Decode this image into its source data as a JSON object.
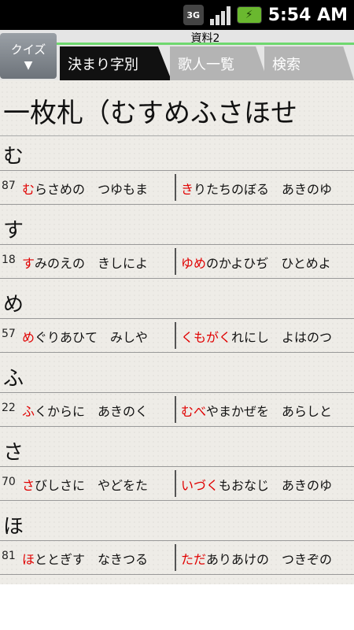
{
  "status_bar": {
    "network": "3G",
    "time": "5:54 AM"
  },
  "header": {
    "quiz_label": "クイズ",
    "quiz_arrow": "▼",
    "section_title": "資料2",
    "tabs": [
      {
        "label": "決まり字別",
        "active": true
      },
      {
        "label": "歌人一覧",
        "active": false
      },
      {
        "label": "検索",
        "active": false
      }
    ]
  },
  "content": {
    "title": "一枚札（むすめふさほせ",
    "groups": [
      {
        "heading": "む",
        "number": "87",
        "left_kimari": "む",
        "left_rest": "らさめの　つゆもま",
        "right_kimari": "き",
        "right_rest": "りたちのぼる　あきのゆ"
      },
      {
        "heading": "す",
        "number": "18",
        "left_kimari": "す",
        "left_rest": "みのえの　きしによ",
        "right_kimari": "ゆめ",
        "right_rest": "のかよひぢ　ひとめよ"
      },
      {
        "heading": "め",
        "number": "57",
        "left_kimari": "め",
        "left_rest": "ぐりあひて　みしや",
        "right_kimari": "くもがく",
        "right_rest": "れにし　よはのつ"
      },
      {
        "heading": "ふ",
        "number": "22",
        "left_kimari": "ふ",
        "left_rest": "くからに　あきのく",
        "right_kimari": "むべ",
        "right_rest": "やまかぜを　あらしと"
      },
      {
        "heading": "さ",
        "number": "70",
        "left_kimari": "さ",
        "left_rest": "びしさに　やどをた",
        "right_kimari": "いづく",
        "right_rest": "もおなじ　あきのゆ"
      },
      {
        "heading": "ほ",
        "number": "81",
        "left_kimari": "ほ",
        "left_rest": "ととぎす　なきつる",
        "right_kimari": "ただ",
        "right_rest": "ありあけの　つきぞの"
      }
    ]
  },
  "colors": {
    "kimari": "#e00000",
    "accent_line": "#6fd86f"
  }
}
